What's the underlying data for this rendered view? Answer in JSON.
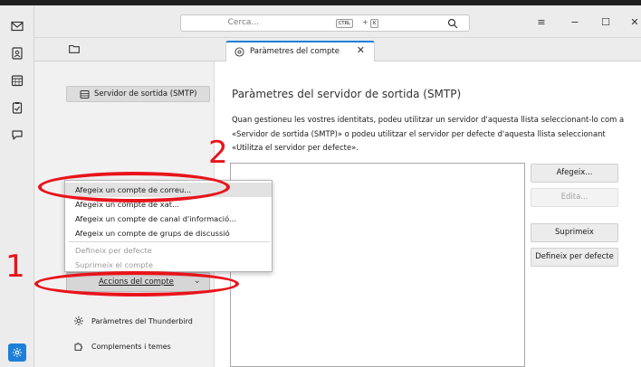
{
  "search": {
    "placeholder": "Cerca...",
    "kbd_ctrl": "CTRL",
    "kbd_plus": "+",
    "kbd_key": "K"
  },
  "tab": {
    "label": "Paràmetres del compte",
    "close": "✕"
  },
  "sidebar": {
    "smtp_item": "Servidor de sortida (SMTP)",
    "account_actions": "Accions del compte",
    "thunderbird_settings": "Paràmetres del Thunderbird",
    "addons": "Complements i temes"
  },
  "main": {
    "heading": "Paràmetres del servidor de sortida (SMTP)",
    "description": "Quan gestioneu les vostres identitats, podeu utilitzar un servidor d'aquesta llista seleccionant-lo com a «Servidor de sortida (SMTP)» o podeu utilitzar el servidor per defecte d'aquesta llista seleccionant «Utilitza el servidor per defecte».",
    "buttons": {
      "add": "Afegeix...",
      "edit": "Edita...",
      "remove": "Suprimeix",
      "set_default": "Defineix per defecte"
    }
  },
  "menu": {
    "items": [
      "Afegeix un compte de correu...",
      "Afegeix un compte de xat...",
      "Afegeix un compte de canal d'informació...",
      "Afegeix un compte de grups de discussió",
      "Defineix per defecte",
      "Suprimeix el compte"
    ]
  },
  "annotations": {
    "one": "1",
    "two": "2",
    "color": "#e8141a"
  },
  "colors": {
    "accent": "#1e7fd8",
    "toolbar_bg": "#ececec",
    "sidebar_bg": "#f1f1f1"
  },
  "window_controls": [
    "≡",
    "−",
    "☐",
    "✕"
  ]
}
